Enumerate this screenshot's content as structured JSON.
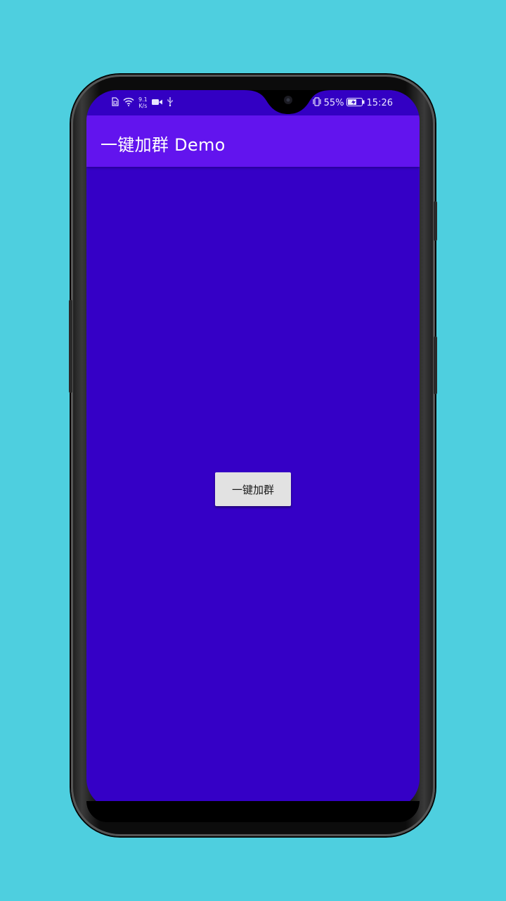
{
  "status_bar": {
    "net_speed_value": "9.1",
    "net_speed_unit": "K/s",
    "battery_percent": "55%",
    "time": "15:26",
    "icons": [
      "sim-card-icon",
      "wifi-icon",
      "video-camera-icon",
      "usb-icon",
      "vibrate-icon",
      "battery-charging-icon"
    ]
  },
  "app_bar": {
    "title": "一键加群 Demo"
  },
  "main": {
    "button_label": "一键加群"
  },
  "colors": {
    "background": "#4ecfdf",
    "screen": "#3500c6",
    "app_bar": "#6214ee",
    "button": "#e2e2e2"
  }
}
